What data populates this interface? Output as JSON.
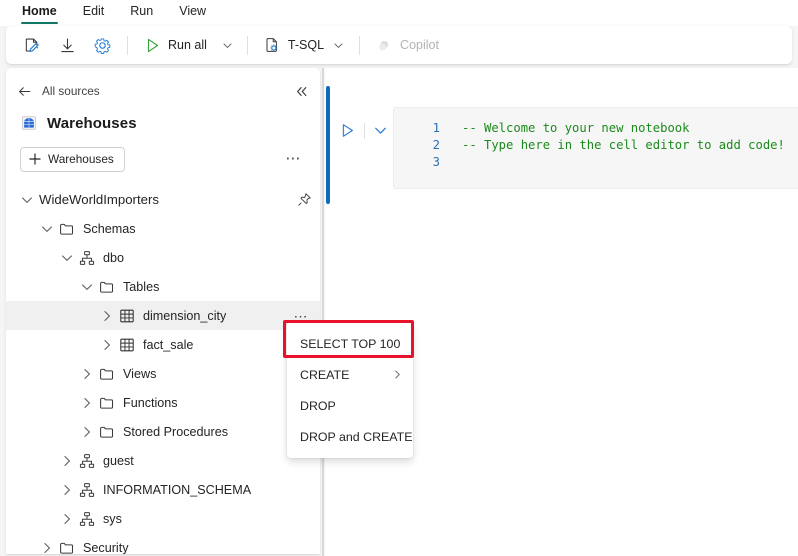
{
  "window": {
    "tabs": [
      {
        "label": "Home",
        "active": true
      },
      {
        "label": "Edit",
        "active": false
      },
      {
        "label": "Run",
        "active": false
      },
      {
        "label": "View",
        "active": false
      }
    ],
    "accent_teal": "#117865",
    "accent_blue": "#0f6cbd",
    "highlight_red": "#e8132b"
  },
  "ribbon": {
    "items": [
      {
        "name": "edit-notebook",
        "icon": "notebook-edit-icon",
        "label": ""
      },
      {
        "name": "download",
        "icon": "download-icon",
        "label": ""
      },
      {
        "name": "settings",
        "icon": "gear-icon",
        "label": ""
      },
      {
        "name": "run-all",
        "icon": "play-icon",
        "label": "Run all",
        "caret": true
      },
      {
        "name": "language",
        "icon": "tsql-icon",
        "label": "T-SQL",
        "caret": true
      },
      {
        "name": "copilot",
        "icon": "copilot-icon",
        "label": "Copilot",
        "disabled": true
      }
    ],
    "run_all_label": "Run all",
    "language_label": "T-SQL",
    "copilot_label": "Copilot"
  },
  "explorer": {
    "back_label": "All sources",
    "collapse_tooltip": "Collapse",
    "header_title": "Warehouses",
    "header_icon": "warehouse-icon",
    "add_button_label": "Warehouses",
    "overflow_label": "•••",
    "tree": [
      {
        "label": "WideWorldImporters",
        "icon": "database-icon",
        "indent": 0,
        "chev": "down",
        "pin": true,
        "selected": false
      },
      {
        "label": "Schemas",
        "icon": "folder-icon",
        "indent": 1,
        "chev": "down",
        "pin": false,
        "selected": false
      },
      {
        "label": "dbo",
        "icon": "schema-icon",
        "indent": 2,
        "chev": "down",
        "pin": false,
        "selected": false
      },
      {
        "label": "Tables",
        "icon": "folder-icon",
        "indent": 3,
        "chev": "down",
        "pin": false,
        "selected": false
      },
      {
        "label": "dimension_city",
        "icon": "table-icon",
        "indent": 4,
        "chev": "right",
        "pin": false,
        "selected": true
      },
      {
        "label": "fact_sale",
        "icon": "table-icon",
        "indent": 4,
        "chev": "right",
        "pin": false,
        "selected": false
      },
      {
        "label": "Views",
        "icon": "folder-icon",
        "indent": 3,
        "chev": "right",
        "pin": false,
        "selected": false
      },
      {
        "label": "Functions",
        "icon": "folder-icon",
        "indent": 3,
        "chev": "right",
        "pin": false,
        "selected": false
      },
      {
        "label": "Stored Procedures",
        "icon": "folder-icon",
        "indent": 3,
        "chev": "right",
        "pin": false,
        "selected": false
      },
      {
        "label": "guest",
        "icon": "schema-icon",
        "indent": 2,
        "chev": "right",
        "pin": false,
        "selected": false
      },
      {
        "label": "INFORMATION_SCHEMA",
        "icon": "schema-icon",
        "indent": 2,
        "chev": "right",
        "pin": false,
        "selected": false
      },
      {
        "label": "sys",
        "icon": "schema-icon",
        "indent": 2,
        "chev": "right",
        "pin": false,
        "selected": false
      },
      {
        "label": "Security",
        "icon": "folder-icon",
        "indent": 1,
        "chev": "right",
        "pin": false,
        "selected": false
      }
    ]
  },
  "context_menu": {
    "highlighted_item": "SELECT TOP 100",
    "items": [
      {
        "label": "SELECT TOP 100",
        "submenu": false,
        "highlighted": true
      },
      {
        "label": "CREATE",
        "submenu": true,
        "highlighted": false
      },
      {
        "label": "DROP",
        "submenu": false,
        "highlighted": false
      },
      {
        "label": "DROP and CREATE",
        "submenu": false,
        "highlighted": false
      }
    ]
  },
  "notebook": {
    "cell": {
      "run_tooltip": "Run cell",
      "more_tooltip": "More commands",
      "lines": [
        {
          "number": "1",
          "text": "-- Welcome to your new notebook"
        },
        {
          "number": "2",
          "text": "-- Type here in the cell editor to add code!"
        },
        {
          "number": "3",
          "text": ""
        }
      ],
      "code_color": "#1c8a1c",
      "linenum_color": "#2a6fb5"
    }
  }
}
